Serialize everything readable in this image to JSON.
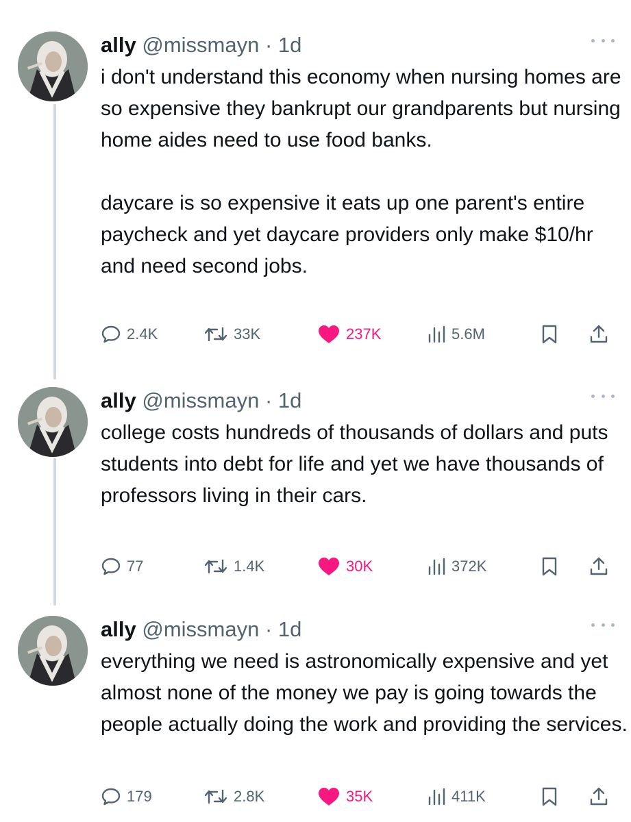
{
  "colors": {
    "like_pink": "#f91880",
    "muted_gray": "#536471",
    "thread_line": "#cfd9de"
  },
  "tweets": [
    {
      "name": "ally",
      "handle": "@missmayn",
      "separator": "·",
      "time": "1d",
      "paragraphs": [
        "i don't understand this economy when nursing homes are so expensive they bankrupt our grandparents but nursing home aides need to use food banks.",
        "daycare is so expensive it eats up one parent's entire paycheck and yet daycare providers only make $10/hr and need second jobs."
      ],
      "replies": "2.4K",
      "retweets": "33K",
      "likes": "237K",
      "views": "5.6M"
    },
    {
      "name": "ally",
      "handle": "@missmayn",
      "separator": "·",
      "time": "1d",
      "paragraphs": [
        "college costs hundreds of thousands of dollars and puts students into debt for life and yet we have thousands of professors living in their cars."
      ],
      "replies": "77",
      "retweets": "1.4K",
      "likes": "30K",
      "views": "372K"
    },
    {
      "name": "ally",
      "handle": "@missmayn",
      "separator": "·",
      "time": "1d",
      "paragraphs": [
        "everything we need is astronomically expensive and yet almost none of the money we pay is going towards the people actually doing the work and providing the services."
      ],
      "replies": "179",
      "retweets": "2.8K",
      "likes": "35K",
      "views": "411K"
    }
  ]
}
